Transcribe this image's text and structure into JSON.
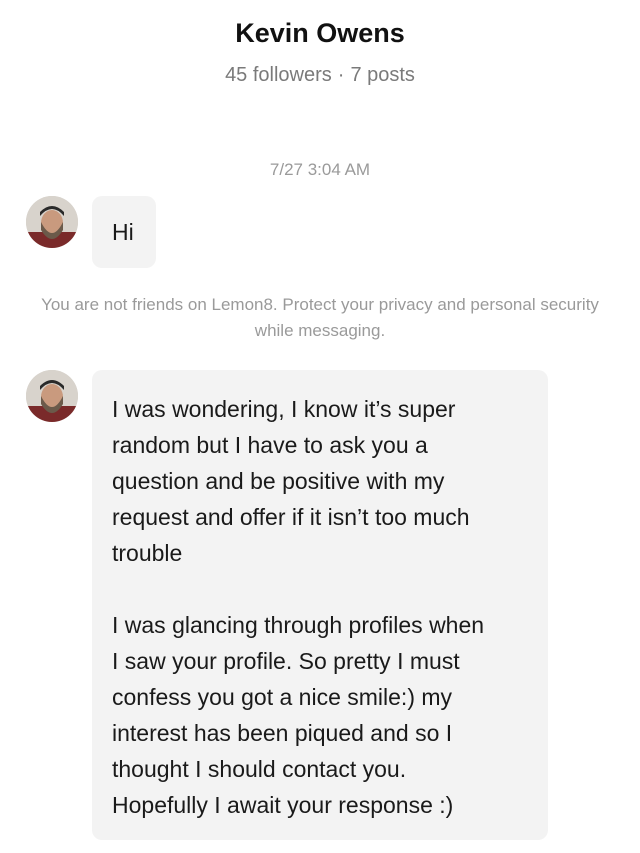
{
  "header": {
    "name": "Kevin Owens",
    "followers": "45 followers",
    "separator": "·",
    "posts": "7 posts"
  },
  "conversation": {
    "timestamp": "7/27 3:04 AM",
    "messages": [
      {
        "sender": "Kevin Owens",
        "text": "Hi"
      },
      {
        "sender": "Kevin Owens",
        "paragraphs": [
          "I was wondering, I know it’s super\nrandom but I have to ask you a\nquestion and be positive with my\nrequest and offer if it isn’t too much\ntrouble",
          "I was glancing through profiles when\nI saw your profile. So pretty I must\nconfess you got a nice smile:) my\ninterest has been piqued and so I\nthought I should contact you.\nHopefully I await your response :)"
        ]
      }
    ],
    "notice": "You are not friends on Lemon8. Protect your privacy and personal security while messaging."
  }
}
